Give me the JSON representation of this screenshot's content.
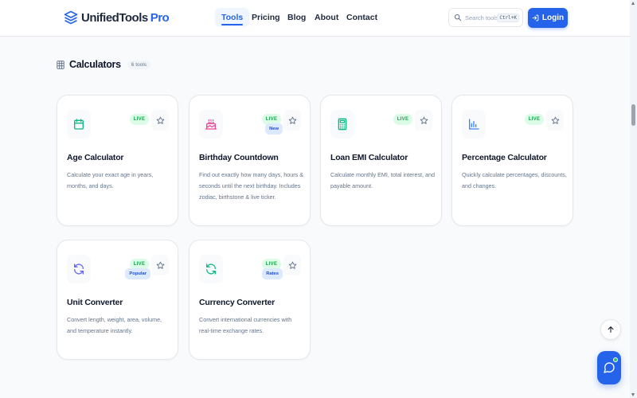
{
  "brand": {
    "name": "UnifiedTools",
    "accent": "Pro"
  },
  "nav": {
    "tools": "Tools",
    "pricing": "Pricing",
    "blog": "Blog",
    "about": "About",
    "contact": "Contact"
  },
  "search": {
    "placeholder": "Search tools...",
    "shortcut": "Ctrl+K"
  },
  "login": {
    "label": "Login"
  },
  "section": {
    "title": "Calculators",
    "count": "6 tools"
  },
  "cards": [
    {
      "title": "Age Calculator",
      "description": "Calculate your exact age in years, months, and days.",
      "badge": "LIVE",
      "icon": "calendar-icon",
      "icon_color": "#10b981"
    },
    {
      "title": "Birthday Countdown",
      "description": "Find out exactly how many days, hours & seconds until the next birthday. Includes zodiac, birthstone & live ticker.",
      "badge": "LIVE",
      "tag": "New",
      "icon": "cake-icon",
      "icon_color": "#ec4899"
    },
    {
      "title": "Loan EMI Calculator",
      "description": "Calculate monthly EMI, total interest, and payable amount.",
      "badge": "LIVE",
      "icon": "calculator-icon",
      "icon_color": "#10b981"
    },
    {
      "title": "Percentage Calculator",
      "description": "Quickly calculate percentages, discounts, and changes.",
      "badge": "LIVE",
      "icon": "bar-chart-icon",
      "icon_color": "#3b82f6"
    },
    {
      "title": "Unit Converter",
      "description": "Convert length, weight, area, volume, and temperature instantly.",
      "badge": "LIVE",
      "tag": "Popular",
      "icon": "refresh-icon",
      "icon_color": "#6366f1"
    },
    {
      "title": "Currency Converter",
      "description": "Convert international currencies with real-time exchange rates.",
      "badge": "LIVE",
      "tag": "Rates",
      "icon": "refresh-icon",
      "icon_color": "#10b981"
    }
  ],
  "colors": {
    "primary": "#2563eb",
    "live_bg": "#dcfce7",
    "live_text": "#16a34a",
    "tag_bg": "#dbeafe",
    "tag_text": "#1d4ed8"
  }
}
